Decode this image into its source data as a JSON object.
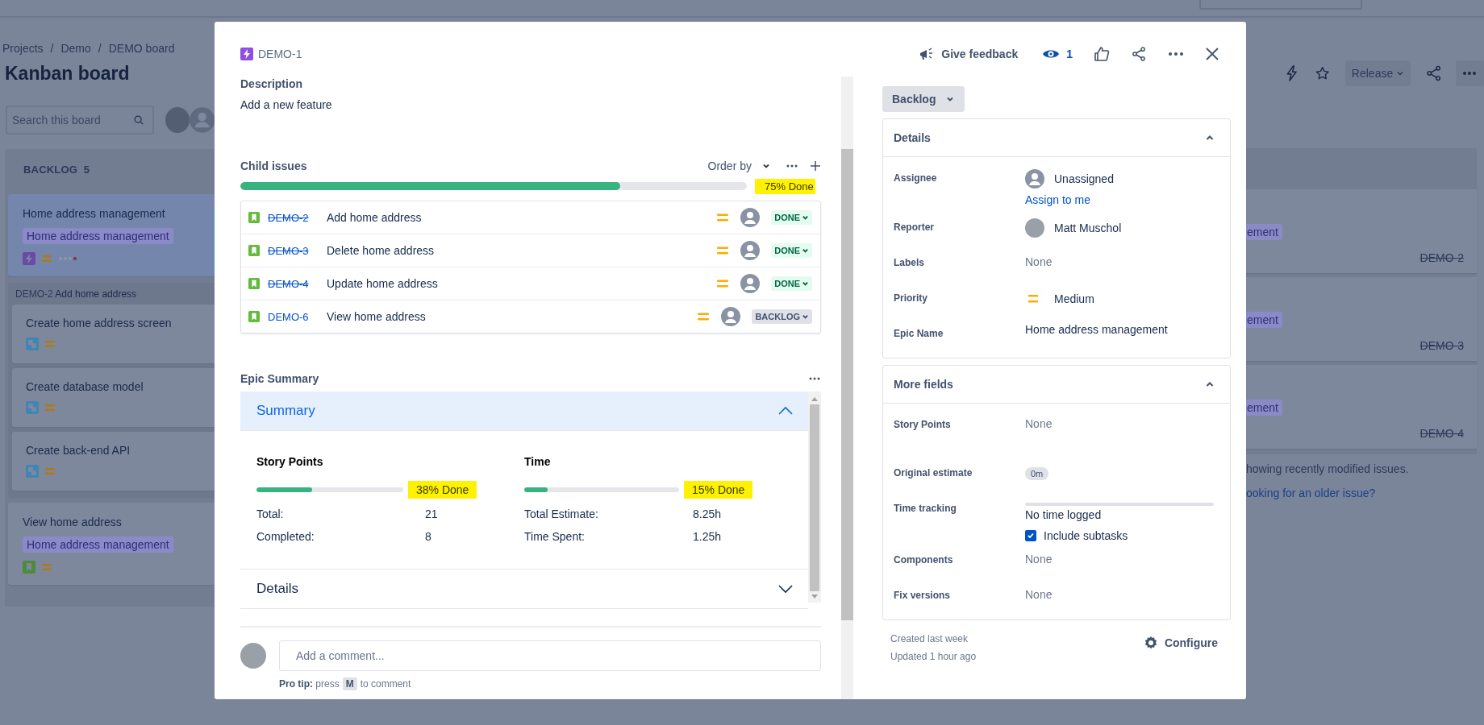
{
  "board": {
    "breadcrumbs": [
      {
        "label": "Projects"
      },
      {
        "label": "Demo"
      },
      {
        "label": "DEMO board"
      }
    ],
    "separator": "/",
    "title": "Kanban board",
    "search": {
      "placeholder": "Search this board"
    },
    "release": "Release",
    "column": {
      "name": "BACKLOG",
      "count": "5",
      "cards": [
        {
          "kind": "epic",
          "title": "Home address management",
          "epic_tag": "Home address management",
          "selected": true,
          "dots": true
        },
        {
          "kind": "group",
          "key": "DEMO-2",
          "title": "Add home address",
          "cards": [
            {
              "title": "Create home address screen",
              "kind": "subtask"
            },
            {
              "title": "Create database model",
              "kind": "subtask"
            },
            {
              "title": "Create back-end API",
              "kind": "subtask"
            }
          ]
        },
        {
          "kind": "story",
          "title": "View home address",
          "epic_tag": "Home address management",
          "selected": false
        }
      ]
    },
    "right_cards": [
      {
        "tag": "ement",
        "key": "DEMO-2",
        "resolved": true
      },
      {
        "tag": "ement",
        "key": "DEMO-3",
        "resolved": true
      },
      {
        "tag": "ement",
        "key": "DEMO-4",
        "resolved": true
      }
    ],
    "note": "howing recently modified issues.",
    "older_link": "ooking for an older issue?"
  },
  "issue": {
    "key": "DEMO-1",
    "kind": "epic",
    "feedback": "Give feedback",
    "watchers": "1",
    "description": {
      "label": "Description",
      "text": "Add a new feature"
    },
    "child_issues": {
      "label": "Child issues",
      "order_by": "Order by",
      "level": 0.75,
      "progress_text": "75% Done",
      "highlighted": true,
      "items": [
        {
          "key": "DEMO-2",
          "title": "Add home address",
          "resolved": true,
          "status": "DONE",
          "kind": "done"
        },
        {
          "key": "DEMO-3",
          "title": "Delete home address",
          "resolved": true,
          "status": "DONE",
          "kind": "done"
        },
        {
          "key": "DEMO-4",
          "title": "Update home address",
          "resolved": true,
          "status": "DONE",
          "kind": "done"
        },
        {
          "key": "DEMO-6",
          "title": "View home address",
          "resolved": false,
          "status": "BACKLOG",
          "kind": "backlog"
        }
      ]
    },
    "epic_summary": {
      "label": "Epic Summary",
      "sections": [
        {
          "title": "Summary",
          "expanded": true,
          "metrics": [
            {
              "title": "Story Points",
              "level": 0.38,
              "progress_text": "38% Done",
              "highlighted": true,
              "rows": [
                {
                  "label": "Total:",
                  "value": "21"
                },
                {
                  "label": "Completed:",
                  "value": "8"
                }
              ]
            },
            {
              "title": "Time",
              "level": 0.15,
              "progress_text": "15% Done",
              "highlighted": true,
              "rows": [
                {
                  "label": "Total Estimate:",
                  "value": "8.25h"
                },
                {
                  "label": "Time Spent:",
                  "value": "1.25h"
                }
              ]
            }
          ]
        },
        {
          "title": "Details",
          "expanded": false
        }
      ]
    },
    "comment": {
      "placeholder": "Add a comment...",
      "tip": "**Pro tip:** press",
      "tip_key": "M",
      "tip_after": "to comment"
    },
    "status_button": "Backlog",
    "details": {
      "title": "Details",
      "expanded": true,
      "fields": [
        {
          "label": "Assignee",
          "kind": "unassigned",
          "value": "Unassigned",
          "action": "Assign to me"
        },
        {
          "label": "Reporter",
          "kind": "user",
          "value": "Matt Muschol"
        },
        {
          "label": "Labels",
          "kind": "empty",
          "value": "None"
        },
        {
          "label": "Priority",
          "kind": "priority",
          "value": "Medium"
        },
        {
          "label": "Epic Name",
          "kind": "text",
          "value": "Home address management"
        }
      ]
    },
    "more_fields": {
      "title": "More fields",
      "expanded": true,
      "fields": [
        {
          "label": "Story Points",
          "kind": "empty",
          "value": "None"
        },
        {
          "label": "Original estimate",
          "kind": "lozenge",
          "value": "0m"
        },
        {
          "label": "Time tracking",
          "kind": "tracking",
          "value": "No time logged",
          "checkbox": {
            "label": "Include subtasks",
            "checked": true
          }
        },
        {
          "label": "Components",
          "kind": "empty",
          "value": "None"
        },
        {
          "label": "Fix versions",
          "kind": "empty",
          "value": "None"
        }
      ]
    },
    "created": "Created last week",
    "updated": "Updated 1 hour ago",
    "configure": "Configure"
  }
}
